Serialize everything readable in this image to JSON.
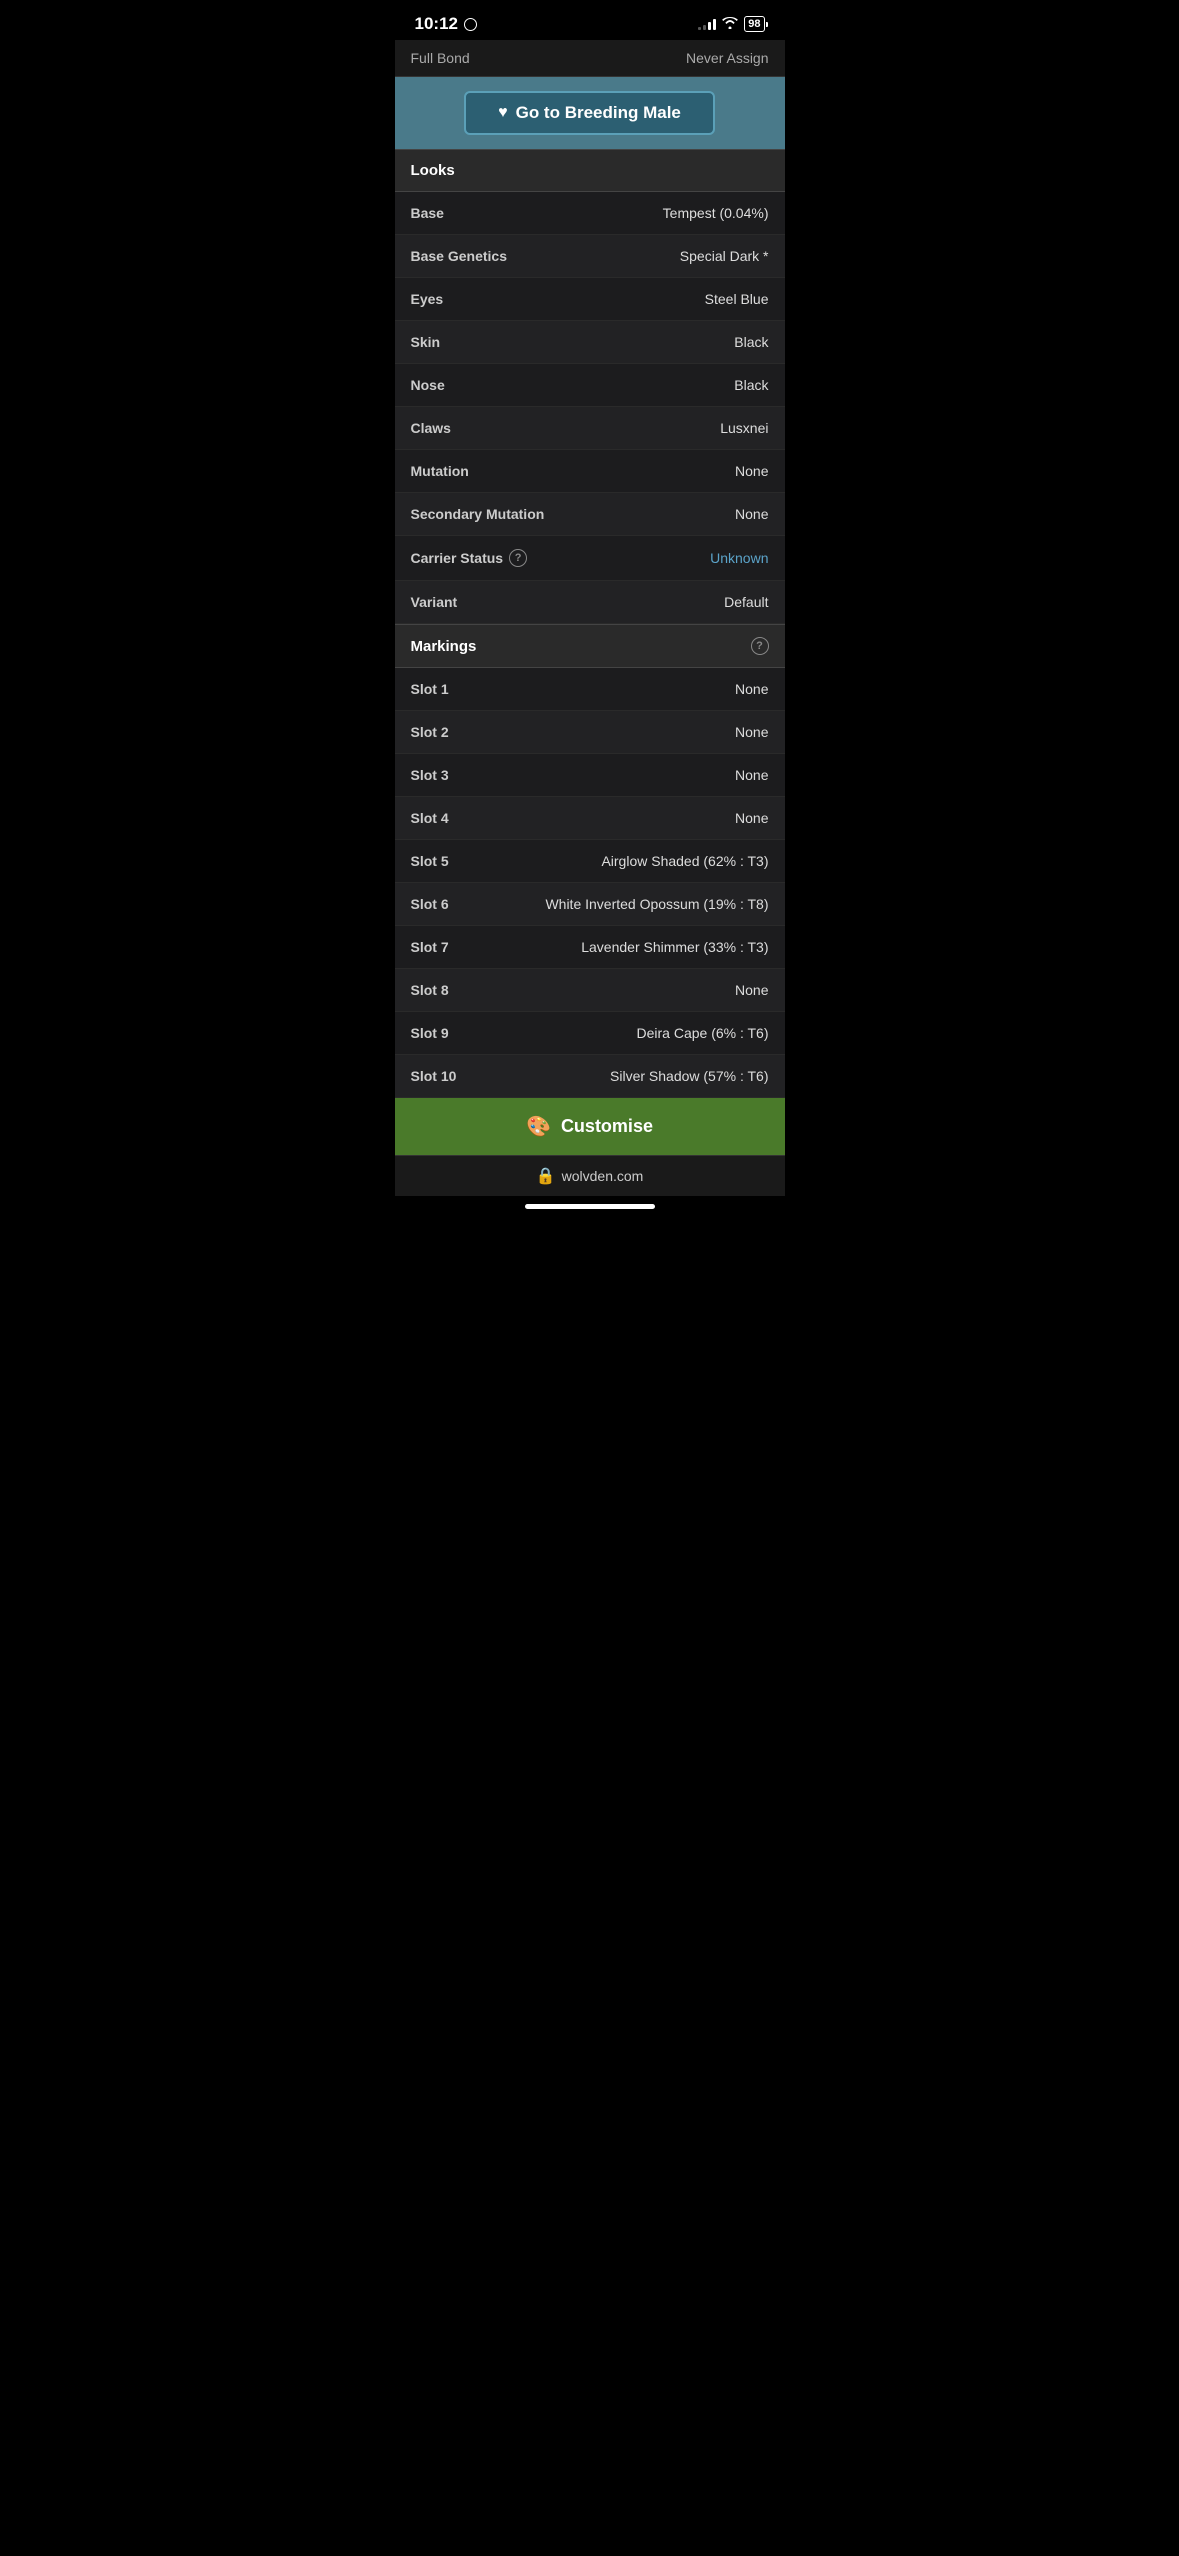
{
  "statusBar": {
    "time": "10:12",
    "battery": "98",
    "signalBars": [
      3,
      5,
      7,
      9,
      11
    ],
    "signalActive": 3
  },
  "header": {
    "title": "Full Bond",
    "action": "Never Assign"
  },
  "breedingButton": {
    "label": "Go to Breeding Male",
    "heartIcon": "♥"
  },
  "looksSection": {
    "title": "Looks",
    "rows": [
      {
        "label": "Base",
        "value": "Tempest (0.04%)",
        "isLink": false
      },
      {
        "label": "Base Genetics",
        "value": "Special Dark *",
        "isLink": false
      },
      {
        "label": "Eyes",
        "value": "Steel Blue",
        "isLink": false
      },
      {
        "label": "Skin",
        "value": "Black",
        "isLink": false
      },
      {
        "label": "Nose",
        "value": "Black",
        "isLink": false
      },
      {
        "label": "Claws",
        "value": "Lusxnei",
        "isLink": false
      },
      {
        "label": "Mutation",
        "value": "None",
        "isLink": false
      },
      {
        "label": "Secondary Mutation",
        "value": "None",
        "isLink": false
      },
      {
        "label": "Carrier Status",
        "value": "Unknown",
        "isLink": true,
        "hasHelp": true
      },
      {
        "label": "Variant",
        "value": "Default",
        "isLink": false
      }
    ]
  },
  "markingsSection": {
    "title": "Markings",
    "hasHelp": true,
    "rows": [
      {
        "label": "Slot 1",
        "value": "None"
      },
      {
        "label": "Slot 2",
        "value": "None"
      },
      {
        "label": "Slot 3",
        "value": "None"
      },
      {
        "label": "Slot 4",
        "value": "None"
      },
      {
        "label": "Slot 5",
        "value": "Airglow Shaded (62% : T3)"
      },
      {
        "label": "Slot 6",
        "value": "White Inverted Opossum (19% : T8)"
      },
      {
        "label": "Slot 7",
        "value": "Lavender Shimmer (33% : T3)"
      },
      {
        "label": "Slot 8",
        "value": "None"
      },
      {
        "label": "Slot 9",
        "value": "Deira Cape (6% : T6)"
      },
      {
        "label": "Slot 10",
        "value": "Silver Shadow (57% : T6)"
      }
    ]
  },
  "customiseButton": {
    "label": "Customise",
    "paletteIcon": "🎨"
  },
  "browserBar": {
    "lockIcon": "🔒",
    "url": "wolvden.com"
  },
  "colors": {
    "accent": "#4a7a8a",
    "breedingBtn": "#2c5f72",
    "sectionHeader": "#2a2a2a",
    "tableRow1": "#1c1c1e",
    "tableRow2": "#222224",
    "linkBlue": "#5ba3c9",
    "customise": "#4a7a2a"
  }
}
